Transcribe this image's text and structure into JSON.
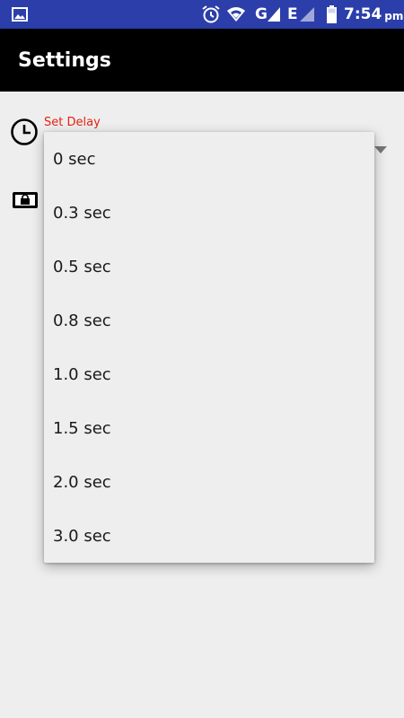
{
  "status_bar": {
    "time": "7:54",
    "time_suffix": "pm",
    "network_letter_1": "G",
    "network_letter_2": "E",
    "icons": [
      "image-icon",
      "alarm-icon",
      "wifi-icon",
      "signal-icon",
      "signal-icon",
      "battery-icon"
    ]
  },
  "app_bar": {
    "title": "Settings"
  },
  "delay_setting": {
    "label": "Set Delay",
    "icons": [
      "clock-icon",
      "dropdown-arrow-icon"
    ]
  },
  "lock_setting": {
    "icon": "lock-icon"
  },
  "dropdown": {
    "options": [
      {
        "label": "0 sec"
      },
      {
        "label": "0.3 sec"
      },
      {
        "label": "0.5 sec"
      },
      {
        "label": "0.8 sec"
      },
      {
        "label": "1.0 sec"
      },
      {
        "label": "1.5 sec"
      },
      {
        "label": "2.0 sec"
      },
      {
        "label": "3.0 sec"
      }
    ]
  },
  "colors": {
    "status_bar": "#2b3eaa",
    "app_bar": "#000000",
    "background": "#eeeeee",
    "label_accent": "#e02312"
  }
}
